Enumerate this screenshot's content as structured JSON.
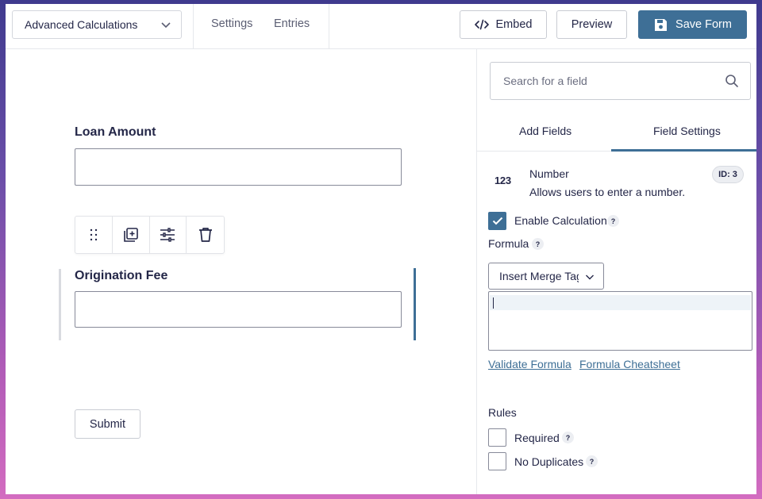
{
  "colors": {
    "accent": "#3e6f96",
    "text": "#242748"
  },
  "topbar": {
    "form_name": "Advanced Calculations",
    "links": [
      "Settings",
      "Entries"
    ],
    "embed_label": "Embed",
    "preview_label": "Preview",
    "save_label": "Save Form"
  },
  "canvas": {
    "fields": [
      {
        "label": "Loan Amount",
        "value": ""
      },
      {
        "label": "Origination Fee",
        "value": ""
      }
    ],
    "toolbar_icons": [
      "drag-handle-icon",
      "duplicate-icon",
      "settings-sliders-icon",
      "trash-icon"
    ],
    "submit_label": "Submit"
  },
  "sidebar": {
    "search_placeholder": "Search for a field",
    "tabs": [
      {
        "label": "Add Fields",
        "active": false
      },
      {
        "label": "Field Settings",
        "active": true
      }
    ],
    "field": {
      "icon_text": "123",
      "title": "Number",
      "description": "Allows users to enter a number.",
      "id_badge": "ID: 3"
    },
    "enable_calculation": {
      "label": "Enable Calculation",
      "checked": true
    },
    "formula_label": "Formula",
    "merge_tag_select": "Insert Merge Tags",
    "formula_value": "",
    "links": [
      "Validate Formula",
      "Formula Cheatsheet"
    ],
    "rules_label": "Rules",
    "rules": [
      {
        "label": "Required",
        "checked": false
      },
      {
        "label": "No Duplicates",
        "checked": false
      }
    ],
    "help_glyph": "?"
  }
}
